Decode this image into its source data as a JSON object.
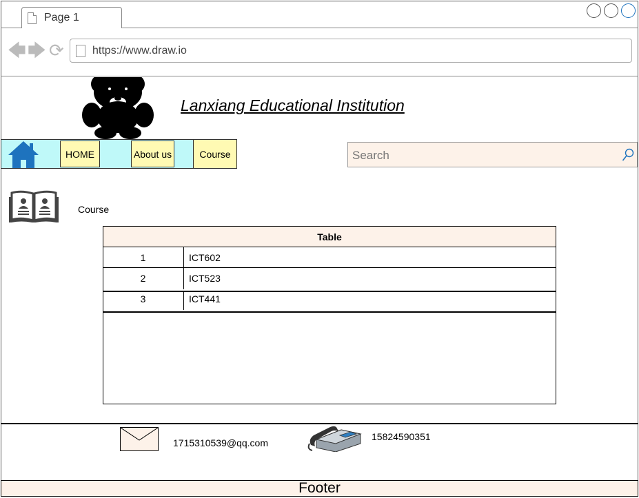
{
  "browser": {
    "tab_label": "Page 1",
    "url": "https://www.draw.io"
  },
  "header": {
    "title": "Lanxiang Educational Institution",
    "logo_icon": "teddy-bear-icon"
  },
  "nav": {
    "home_icon": "home-icon",
    "items": [
      {
        "label": "HOME"
      },
      {
        "label": "About us"
      },
      {
        "label": "Course"
      }
    ],
    "search_placeholder": "Search"
  },
  "main": {
    "section_label": "Course",
    "section_icon": "book-icon",
    "table": {
      "title": "Table",
      "rows": [
        {
          "num": "1",
          "value": "ICT602"
        },
        {
          "num": "2",
          "value": "ICT523"
        },
        {
          "num": "3",
          "value": "ICT441"
        }
      ]
    }
  },
  "contact": {
    "email": "1715310539@qq.com",
    "phone": "15824590351"
  },
  "footer": {
    "label": "Footer"
  },
  "colors": {
    "nav_strip": "#bff9f9",
    "nav_button": "#fffab3",
    "peach": "#fdf2e9",
    "home_blue": "#1e73be"
  }
}
